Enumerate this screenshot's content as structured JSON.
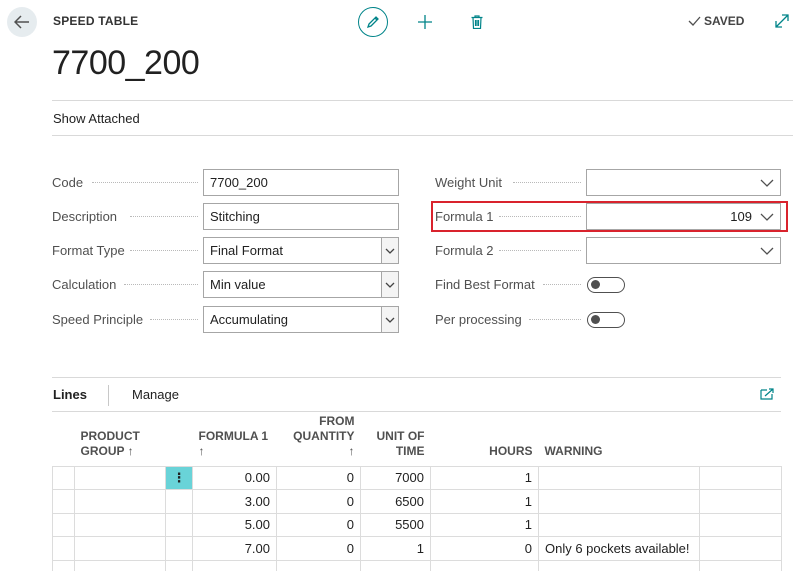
{
  "header": {
    "page_type": "SPEED TABLE",
    "title": "7700_200",
    "saved_label": "SAVED",
    "show_attached": "Show Attached"
  },
  "fields_left": [
    {
      "label": "Code",
      "value": "7700_200",
      "kind": "text"
    },
    {
      "label": "Description",
      "value": "Stitching",
      "kind": "text"
    },
    {
      "label": "Format Type",
      "value": "Final Format",
      "kind": "select"
    },
    {
      "label": "Calculation",
      "value": "Min value",
      "kind": "select"
    },
    {
      "label": "Speed Principle",
      "value": "Accumulating",
      "kind": "select"
    }
  ],
  "fields_right": [
    {
      "label": "Weight Unit",
      "value": "",
      "kind": "dropdown"
    },
    {
      "label": "Formula 1",
      "value": "109",
      "kind": "dropdown",
      "highlighted": true
    },
    {
      "label": "Formula 2",
      "value": "",
      "kind": "dropdown"
    },
    {
      "label": "Find Best Format",
      "value": false,
      "kind": "toggle"
    },
    {
      "label": "Per processing",
      "value": false,
      "kind": "toggle"
    }
  ],
  "lines": {
    "tab_label": "Lines",
    "manage_label": "Manage",
    "columns": {
      "product_group": [
        "PRODUCT",
        "GROUP ↑"
      ],
      "formula1": "FORMULA 1 ↑",
      "from_quantity": [
        "FROM",
        "QUANTITY",
        "↑"
      ],
      "unit_of_time": [
        "UNIT OF",
        "TIME"
      ],
      "hours": "HOURS",
      "warning": "WARNING"
    },
    "rows": [
      {
        "product_group": "",
        "formula1": "0.00",
        "from_quantity": "0",
        "unit_of_time": "7000",
        "hours": "1",
        "warning": ""
      },
      {
        "product_group": "",
        "formula1": "3.00",
        "from_quantity": "0",
        "unit_of_time": "6500",
        "hours": "1",
        "warning": ""
      },
      {
        "product_group": "",
        "formula1": "5.00",
        "from_quantity": "0",
        "unit_of_time": "5500",
        "hours": "1",
        "warning": ""
      },
      {
        "product_group": "",
        "formula1": "7.00",
        "from_quantity": "0",
        "unit_of_time": "1",
        "hours": "0",
        "warning": "Only 6 pockets available!"
      }
    ],
    "row_menu_glyph": "⋮"
  },
  "colors": {
    "accent": "#008489",
    "highlight_border": "#d9232d",
    "row_menu_bg": "#69d3d8"
  },
  "icons": [
    "back-arrow-icon",
    "pencil-icon",
    "plus-icon",
    "trash-icon",
    "checkmark-icon",
    "expand-icon",
    "chevron-down-icon",
    "open-in-new-icon"
  ]
}
